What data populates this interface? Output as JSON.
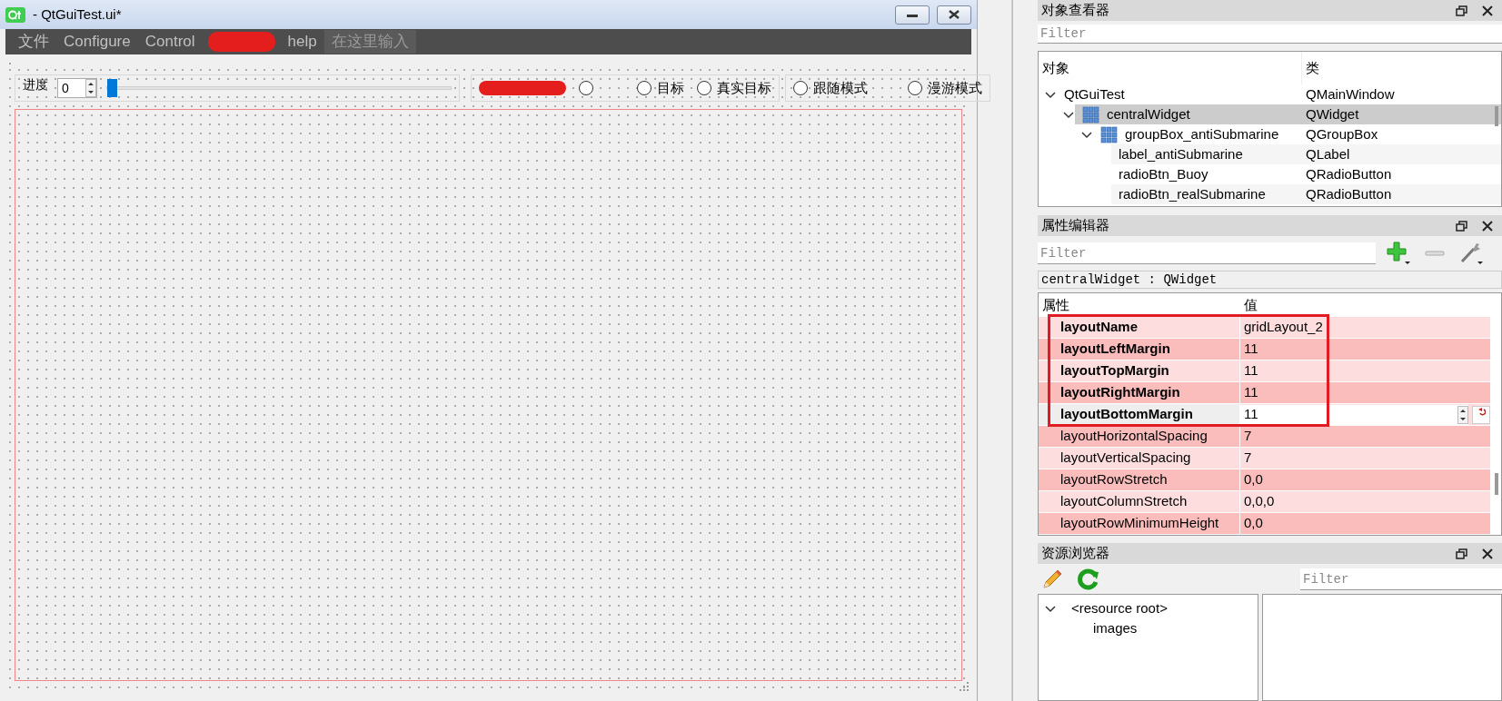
{
  "designer_window": {
    "title": "- QtGuiTest.ui*",
    "menu": [
      {
        "kind": "item",
        "label": "文件"
      },
      {
        "kind": "item",
        "label": "Configure"
      },
      {
        "kind": "item",
        "label": "Control"
      },
      {
        "kind": "redacted"
      },
      {
        "kind": "item",
        "label": "help"
      },
      {
        "kind": "placeholder",
        "label": "在这里输入"
      }
    ],
    "progress_label": "进度",
    "spin_value": "0",
    "slider": {
      "level": 0
    },
    "radio_groups": [
      {
        "radios": [
          {
            "kind": "redacted",
            "selected": false
          },
          {
            "kind": "plain",
            "label": "目标",
            "selected": false
          },
          {
            "kind": "plain",
            "label": "真实目标",
            "selected": false
          }
        ]
      },
      {
        "radios": [
          {
            "kind": "plain",
            "label": "跟随模式",
            "selected": false
          },
          {
            "kind": "plain",
            "label": "漫游模式",
            "selected": false
          }
        ]
      }
    ]
  },
  "object_inspector": {
    "title": "对象查看器",
    "filter_placeholder": "Filter",
    "columns": [
      "对象",
      "类"
    ],
    "tree": [
      {
        "name": "QtGuiTest",
        "class": "QMainWindow",
        "icon": false,
        "selected": false,
        "expanded": true,
        "children": [
          {
            "name": "centralWidget",
            "class": "QWidget",
            "icon": true,
            "selected": true,
            "expanded": true,
            "children": [
              {
                "name": "groupBox_antiSubmarine",
                "class": "QGroupBox",
                "icon": true,
                "selected": false,
                "expanded": true,
                "children": [
                  {
                    "name": "label_antiSubmarine",
                    "class": "QLabel",
                    "icon": false,
                    "selected": false
                  },
                  {
                    "name": "radioBtn_Buoy",
                    "class": "QRadioButton",
                    "icon": false,
                    "selected": false
                  },
                  {
                    "name": "radioBtn_realSubmarine",
                    "class": "QRadioButton",
                    "icon": false,
                    "selected": false
                  }
                ]
              }
            ]
          }
        ]
      }
    ]
  },
  "property_editor": {
    "title": "属性编辑器",
    "filter_placeholder": "Filter",
    "object_label": "centralWidget : QWidget",
    "columns": [
      "属性",
      "值"
    ],
    "rows": [
      {
        "name": "layoutName",
        "value": "gridLayout_2",
        "bold": true,
        "editing": false,
        "annotated": true
      },
      {
        "name": "layoutLeftMargin",
        "value": "11",
        "bold": true,
        "editing": false,
        "annotated": true
      },
      {
        "name": "layoutTopMargin",
        "value": "11",
        "bold": true,
        "editing": false,
        "annotated": true
      },
      {
        "name": "layoutRightMargin",
        "value": "11",
        "bold": true,
        "editing": false,
        "annotated": true
      },
      {
        "name": "layoutBottomMargin",
        "value": "11",
        "bold": true,
        "editing": true,
        "annotated": true
      },
      {
        "name": "layoutHorizontalSpacing",
        "value": "7",
        "bold": false,
        "editing": false,
        "annotated": false
      },
      {
        "name": "layoutVerticalSpacing",
        "value": "7",
        "bold": false,
        "editing": false,
        "annotated": false
      },
      {
        "name": "layoutRowStretch",
        "value": "0,0",
        "bold": false,
        "editing": false,
        "annotated": false
      },
      {
        "name": "layoutColumnStretch",
        "value": "0,0,0",
        "bold": false,
        "editing": false,
        "annotated": false
      },
      {
        "name": "layoutRowMinimumHeight",
        "value": "0,0",
        "bold": false,
        "editing": false,
        "annotated": false
      }
    ]
  },
  "resource_browser": {
    "title": "资源浏览器",
    "filter_placeholder": "Filter",
    "tree": [
      {
        "name": "<resource root>",
        "expanded": true,
        "children": [
          {
            "name": "images"
          }
        ]
      }
    ]
  }
}
